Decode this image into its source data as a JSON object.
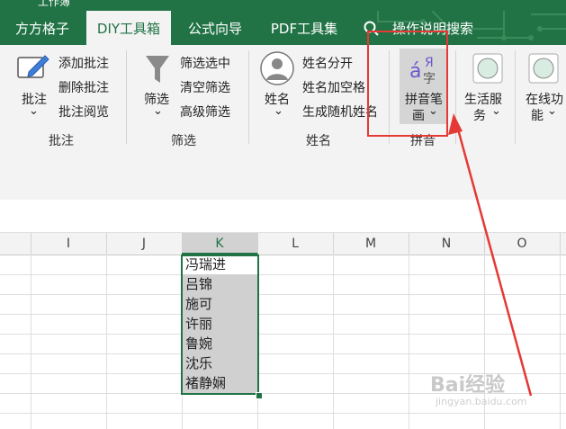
{
  "app": {
    "title": "工作簿"
  },
  "tabs": [
    {
      "label": "方方格子"
    },
    {
      "label": "DIY工具箱"
    },
    {
      "label": "公式向导"
    },
    {
      "label": "PDF工具集"
    }
  ],
  "search": {
    "placeholder": "操作说明搜索"
  },
  "ribbon": {
    "comment_group": {
      "big_label": "批注",
      "add": "添加批注",
      "delete": "删除批注",
      "browse": "批注阅览",
      "group_label": "批注"
    },
    "filter_group": {
      "big_label": "筛选",
      "select_filter": "筛选选中",
      "clear_filter": "清空筛选",
      "advanced_filter": "高级筛选",
      "group_label": "筛选"
    },
    "name_group": {
      "big_label": "姓名",
      "split": "姓名分开",
      "add_space": "姓名加空格",
      "random": "生成随机姓名",
      "group_label": "姓名"
    },
    "pinyin_group": {
      "big_label_line1": "拼音笔",
      "big_label_line2": "画",
      "group_label": "拼音"
    },
    "life_service": {
      "line1": "生活服",
      "line2": "务"
    },
    "online": {
      "line1": "在线功",
      "line2": "能"
    }
  },
  "grid": {
    "columns": [
      "I",
      "J",
      "K",
      "L",
      "M",
      "N",
      "O"
    ],
    "selected_column": "K",
    "cells": [
      "冯瑞进",
      "吕锦",
      "施可",
      "许丽",
      "鲁婉",
      "沈乐",
      "褚静娴"
    ]
  },
  "watermark": {
    "brand": "Bai经验",
    "url": "jingyan.baidu.com"
  },
  "colors": {
    "accent": "#217346",
    "annotation": "#e53935"
  }
}
